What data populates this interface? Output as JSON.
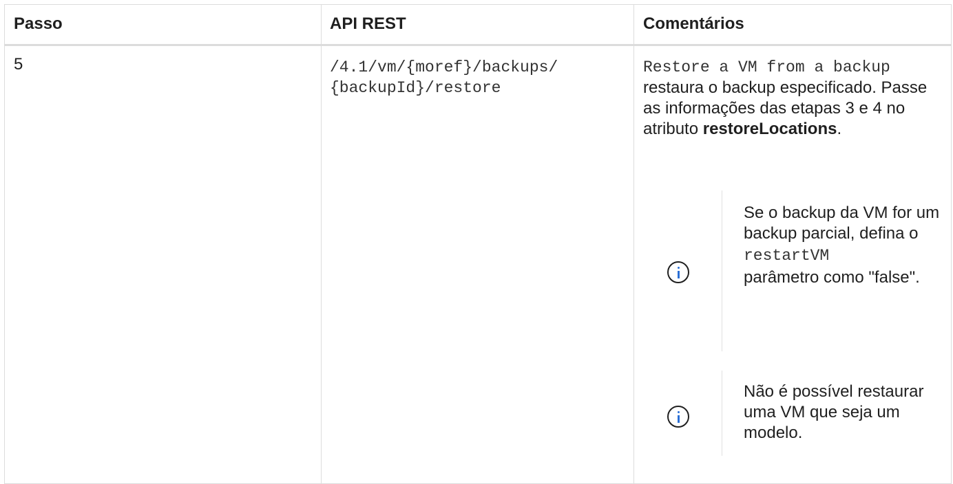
{
  "table": {
    "headers": [
      "Passo",
      "API REST",
      "Comentários"
    ],
    "row": {
      "step": "5",
      "api_line1": "/4.1/vm/{moref}/backups/",
      "api_line2": "{backupId}/restore",
      "comment_code": "Restore a VM from a backup",
      "comment_text1": "restaura o backup especificado. Passe as informações das etapas 3 e 4 no atributo",
      "comment_bold": "restoreLocations",
      "comment_end": ".",
      "notes": [
        {
          "icon": "info-icon",
          "text_before": "Se o backup da VM for um backup parcial, defina o",
          "code": "restartVM",
          "text_after": "parâmetro como \"false\"."
        },
        {
          "icon": "info-icon",
          "text": "Não é possível restaurar uma VM que seja um modelo."
        }
      ]
    }
  },
  "colors": {
    "border": "#dcdcdc",
    "icon_accent": "#2a6fd6"
  }
}
